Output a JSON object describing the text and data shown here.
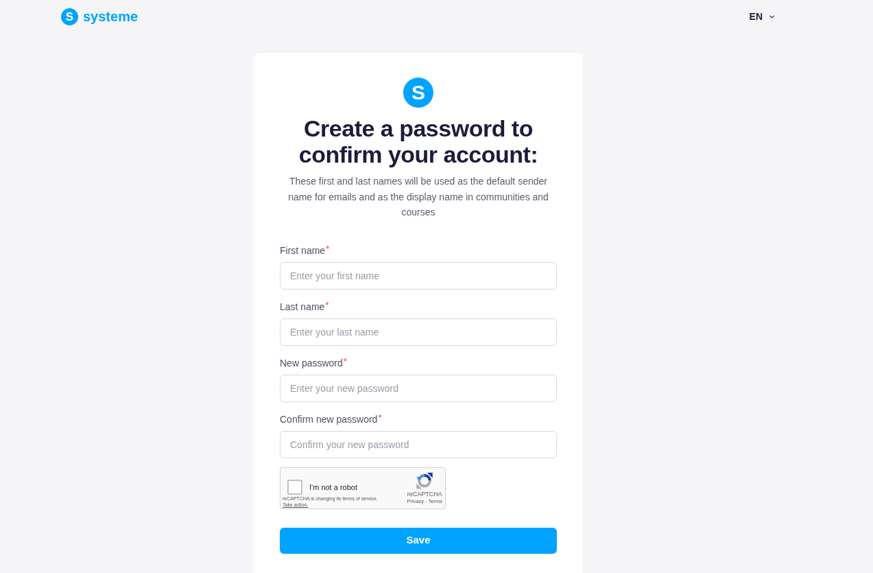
{
  "header": {
    "logo": {
      "mark": "S",
      "name": "systeme"
    },
    "language": "EN"
  },
  "card": {
    "logo_mark": "S",
    "title": "Create a password to confirm your account:",
    "description": "These first and last names will be used as the default sender name for emails and as the display name in communities and courses",
    "fields": [
      {
        "label": "First name",
        "required_mark": "*",
        "placeholder": "Enter your first name"
      },
      {
        "label": "Last name",
        "required_mark": "*",
        "placeholder": "Enter your last name"
      },
      {
        "label": "New password",
        "required_mark": "*",
        "placeholder": "Enter your new password"
      },
      {
        "label": "Confirm new password",
        "required_mark": "*",
        "placeholder": "Confirm your new password"
      }
    ],
    "captcha": {
      "checked": false,
      "label": "I'm not a robot",
      "notice": "reCAPTCHA is changing its terms of service.",
      "notice_link": "Take action.",
      "brand": "reCAPTCHA",
      "links": [
        "Privacy",
        "Terms"
      ],
      "separator": "-"
    },
    "submit": "Save"
  }
}
